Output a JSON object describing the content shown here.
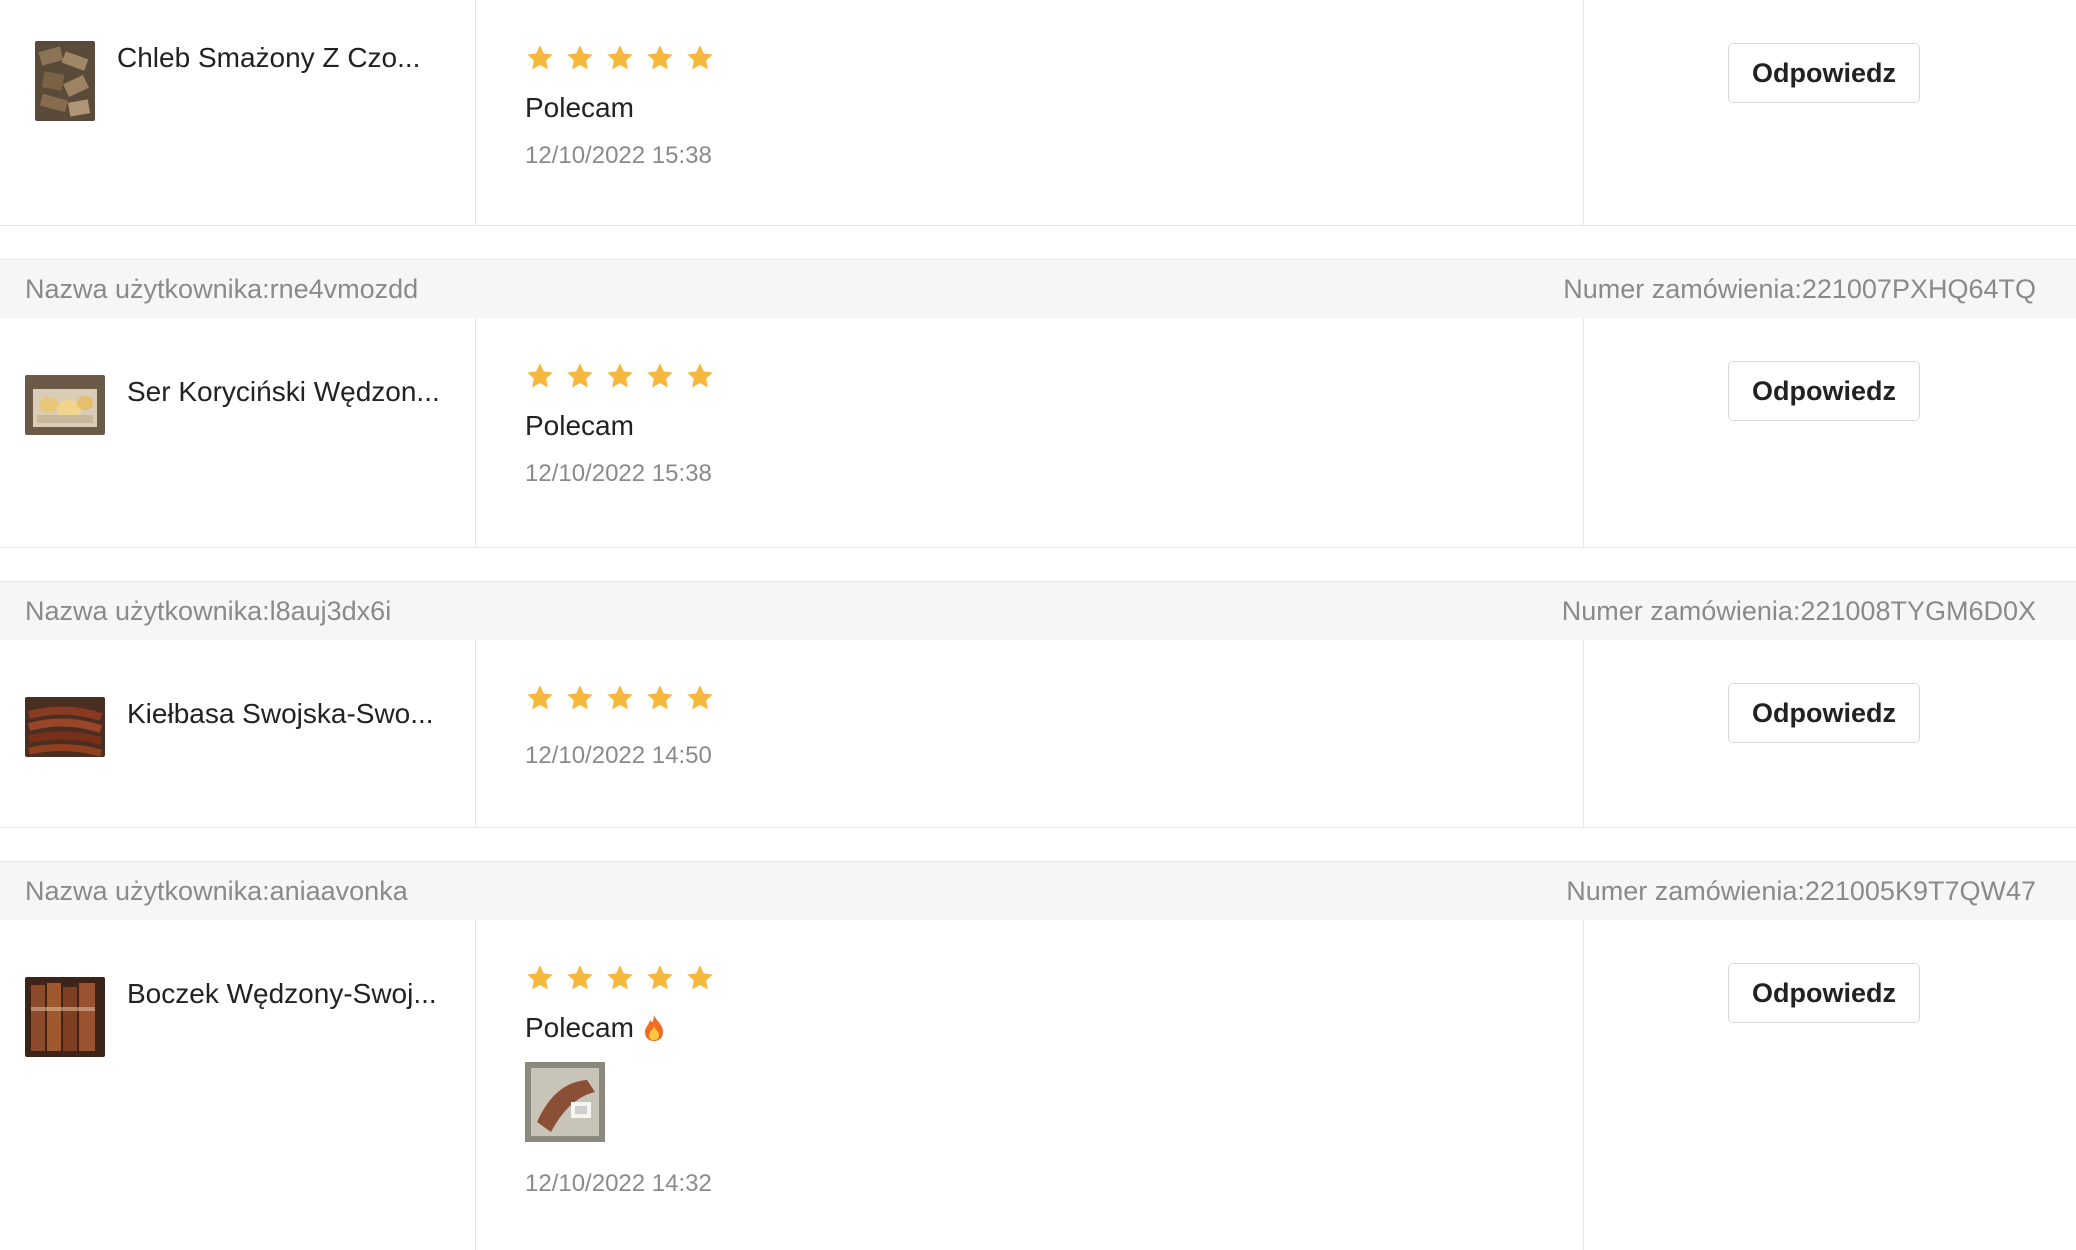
{
  "labels": {
    "user_prefix": "Nazwa użytkownika:",
    "order_prefix": "Numer zamówienia:",
    "reply": "Odpowiedz"
  },
  "colors": {
    "star": "#f5b83d",
    "muted": "#8a8a8a",
    "header_bg": "#f6f6f6"
  },
  "reviews": [
    {
      "user_label": "",
      "order_label": "",
      "product_name": "Chleb Smażony Z Czo...",
      "rating": 5,
      "comment": "Polecam",
      "date": "12/10/2022 15:38",
      "reply_label": "Odpowiedz"
    },
    {
      "user_label": "Nazwa użytkownika:rne4vmozdd",
      "order_label": "Numer zamówienia:221007PXHQ64TQ",
      "product_name": "Ser Koryciński Wędzon...",
      "rating": 5,
      "comment": "Polecam",
      "date": "12/10/2022 15:38",
      "reply_label": "Odpowiedz"
    },
    {
      "user_label": "Nazwa użytkownika:l8auj3dx6i",
      "order_label": "Numer zamówienia:221008TYGM6D0X",
      "product_name": "Kiełbasa Swojska-Swo...",
      "rating": 5,
      "comment": "",
      "date": "12/10/2022 14:50",
      "reply_label": "Odpowiedz"
    },
    {
      "user_label": "Nazwa użytkownika:aniaavonka",
      "order_label": "Numer zamówienia:221005K9T7QW47",
      "product_name": "Boczek Wędzony-Swoj...",
      "rating": 5,
      "comment": "Polecam",
      "comment_icon": "fire-emoji-icon",
      "date": "12/10/2022 14:32",
      "reply_label": "Odpowiedz"
    }
  ]
}
